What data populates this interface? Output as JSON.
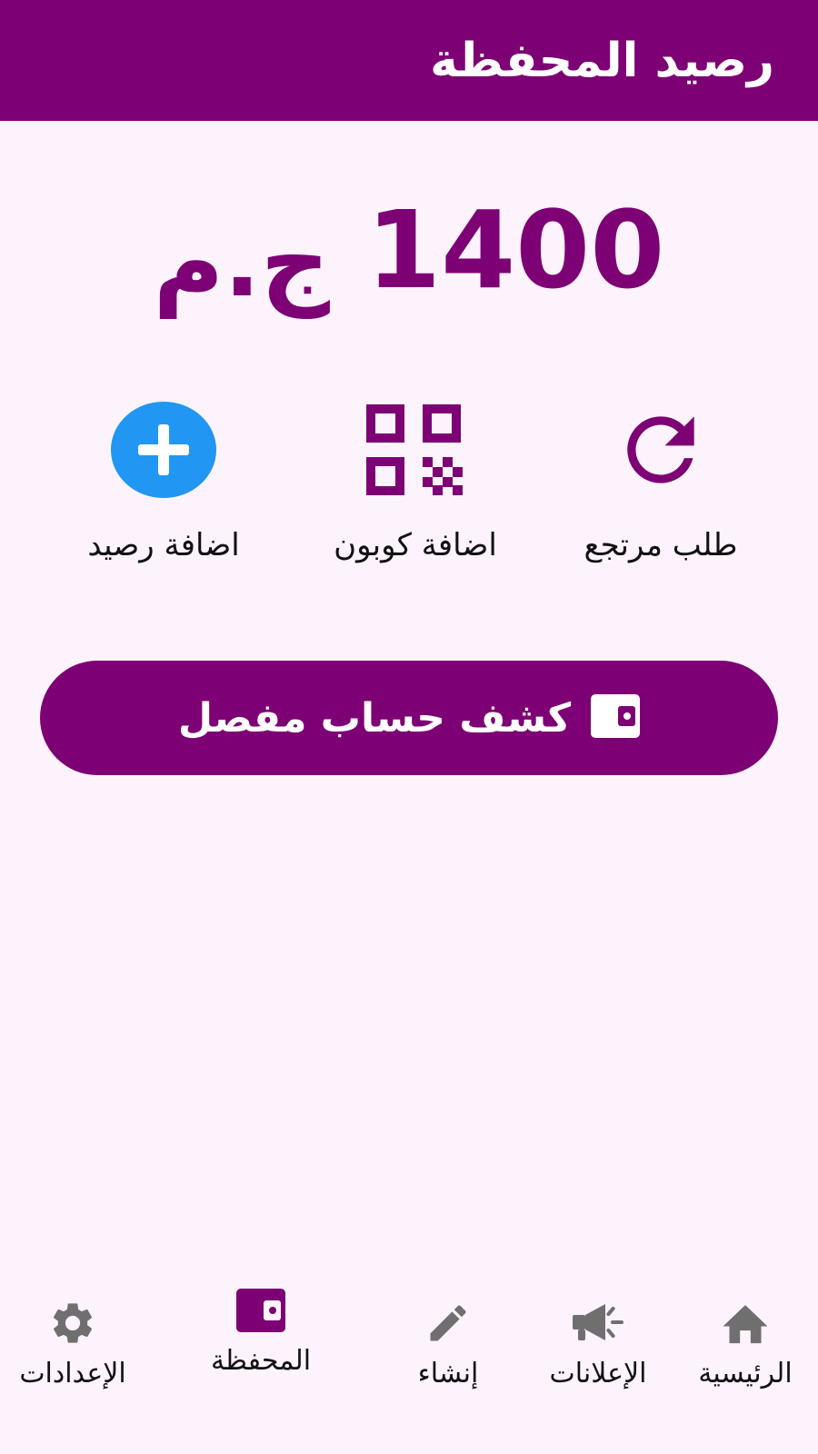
{
  "app_bar": {
    "title": "رصيد المحفظة"
  },
  "colors": {
    "primary": "#7d0074",
    "accent_blue": "#2196f3",
    "background": "#fcf3fd",
    "icon_grey": "#6f6f6f"
  },
  "balance": {
    "amount": "1400",
    "currency": "ج.م"
  },
  "actions": [
    {
      "label": "طلب مرتجع",
      "icon": "refresh-icon"
    },
    {
      "label": "اضافة كوبون",
      "icon": "qr-code-icon"
    },
    {
      "label": "اضافة رصيد",
      "icon": "plus-circle-icon"
    }
  ],
  "statement_button": {
    "label": "كشف حساب مفصل",
    "icon": "wallet-icon"
  },
  "bottom_nav": [
    {
      "label": "الرئيسية",
      "icon": "home-icon",
      "active": false
    },
    {
      "label": "الإعلانات",
      "icon": "megaphone-icon",
      "active": false
    },
    {
      "label": "إنشاء",
      "icon": "pencil-icon",
      "active": false
    },
    {
      "label": "المحفظة",
      "icon": "wallet-icon",
      "active": true
    },
    {
      "label": "الإعدادات",
      "icon": "gear-icon",
      "active": false
    }
  ]
}
